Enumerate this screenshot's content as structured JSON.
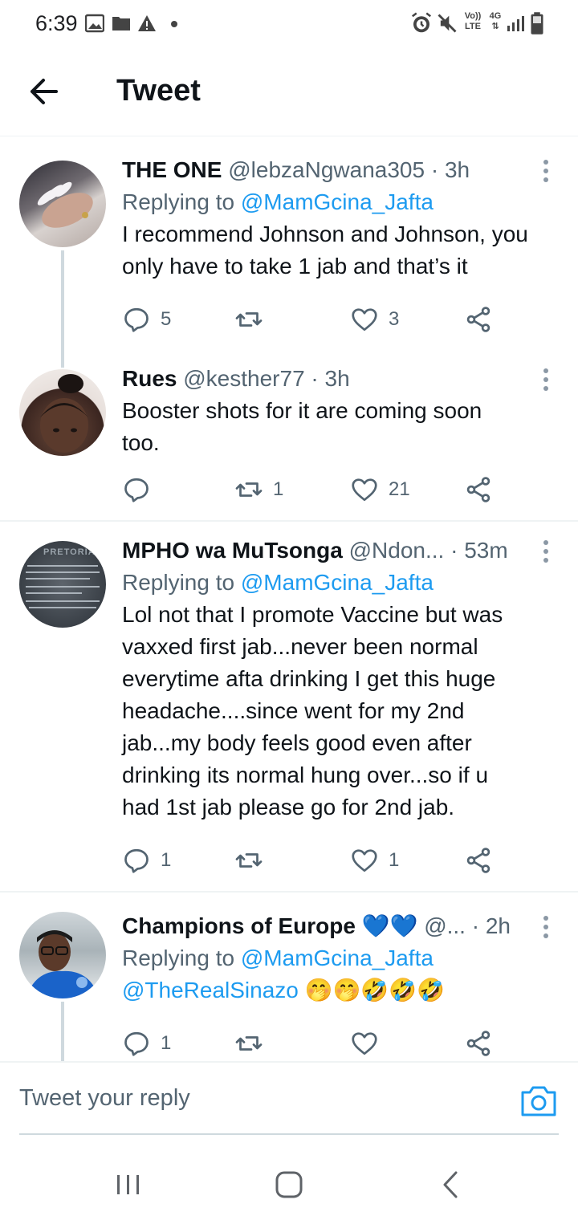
{
  "status_bar": {
    "time": "6:39",
    "left_icons": [
      "image-icon",
      "folder-icon",
      "warning-icon",
      "dot-icon"
    ],
    "right_icons": [
      "alarm-icon",
      "mute-icon",
      "volte-icon",
      "4g-icon",
      "signal-icon",
      "battery-icon"
    ],
    "volte_label_top": "Vo))",
    "volte_label_bottom": "LTE",
    "network_label": "4G"
  },
  "header": {
    "title": "Tweet"
  },
  "tweets": [
    {
      "name": "THE ONE",
      "handle": "@lebzaNgwana305",
      "separator": "·",
      "time": "3h",
      "reply_prefix": "Replying to",
      "reply_to": "@MamGcina_Jafta",
      "text_lines": [
        "I recommend Johnson and Johnson, you",
        "only have to take 1 jab and that’s it"
      ],
      "replies": "5",
      "retweets": "",
      "likes": "3"
    },
    {
      "name": "Rues",
      "handle": "@kesther77",
      "separator": "·",
      "time": "3h",
      "text_lines": [
        "Booster shots for it are coming soon",
        "too."
      ],
      "replies": "",
      "retweets": "1",
      "likes": "21"
    },
    {
      "name": "MPHO wa MuTsonga",
      "handle": "@Ndon...",
      "separator": "·",
      "time": "53m",
      "reply_prefix": "Replying to",
      "reply_to": "@MamGcina_Jafta",
      "text_lines": [
        "Lol not that I promote Vaccine but was",
        "vaxxed first jab...never been normal",
        "everytime afta drinking I get this huge",
        "headache....since went for my 2nd",
        "jab...my body feels good even after",
        "drinking its normal hung over...so if u",
        "had 1st jab please go for 2nd jab."
      ],
      "avatar_text": "PRETORIA",
      "replies": "1",
      "retweets": "",
      "likes": "1"
    },
    {
      "name": "Champions of Europe",
      "name_emoji": "💙💙",
      "handle": "@...",
      "separator": "·",
      "time": "2h",
      "reply_prefix": "Replying to",
      "reply_to": "@MamGcina_Jafta",
      "mention_line": "@TheRealSinazo",
      "emojis": "🤭🤭🤣🤣🤣",
      "replies": "1",
      "retweets": "",
      "likes": ""
    }
  ],
  "composer": {
    "placeholder": "Tweet your reply"
  },
  "colors": {
    "accent": "#1d9bf0",
    "text": "#0f1419",
    "secondary": "#536471",
    "divider": "#eff3f4",
    "thread_line": "#cfd9de"
  }
}
